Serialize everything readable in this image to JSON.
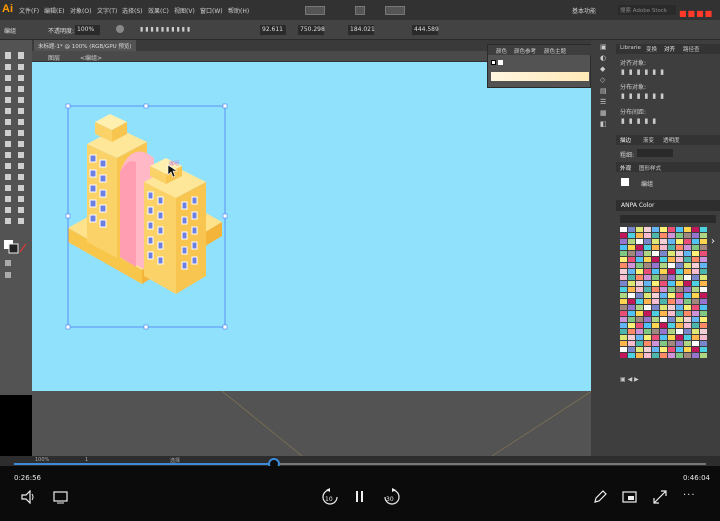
{
  "app": {
    "logo": "Ai"
  },
  "menu": [
    "文件(F)",
    "编辑(E)",
    "对象(O)",
    "文字(T)",
    "选择(S)",
    "效果(C)",
    "视图(V)",
    "窗口(W)",
    "帮助(H)"
  ],
  "window_controls": {
    "search_placeholder": "搜索 Adobe Stock",
    "workspace": "基本功能"
  },
  "control_bar": {
    "label_left": "编组",
    "opacity_label": "不透明度:",
    "opacity_value": "100%",
    "x_value": "92.611",
    "y_value": "750.298",
    "w_value": "184.021",
    "h_value": "444.589"
  },
  "document_tab": {
    "title": "未标题-1* @ 100% (RGB/GPU 预览)"
  },
  "breadcrumb": {
    "layer": "图层",
    "group": "<编组>"
  },
  "color_panel": {
    "tabs": [
      "颜色",
      "颜色参考",
      "颜色主题"
    ]
  },
  "right_panel": {
    "tabs": [
      "Librarie",
      "变换",
      "对齐",
      "路径查"
    ],
    "align_title": "对齐对象:",
    "distribute_title": "分布对象:",
    "spacing_title": "分布间距:",
    "appearance_tabs": [
      "描边",
      "渐变",
      "透明度"
    ],
    "stroke_weight_label": "粗细:",
    "appearance_title": "外观",
    "graphic_style_tab": "图形样式",
    "group_label": "编组",
    "anpa_title": "ANPA Color"
  },
  "status": {
    "zoom": "100%",
    "page": "1",
    "tool_name": "选择"
  },
  "player": {
    "current_time": "0:26:56",
    "total_time": "0:46:04",
    "progress": 0.375,
    "skip_back_label": "10",
    "skip_forward_label": "30"
  },
  "selection_label": "编组"
}
